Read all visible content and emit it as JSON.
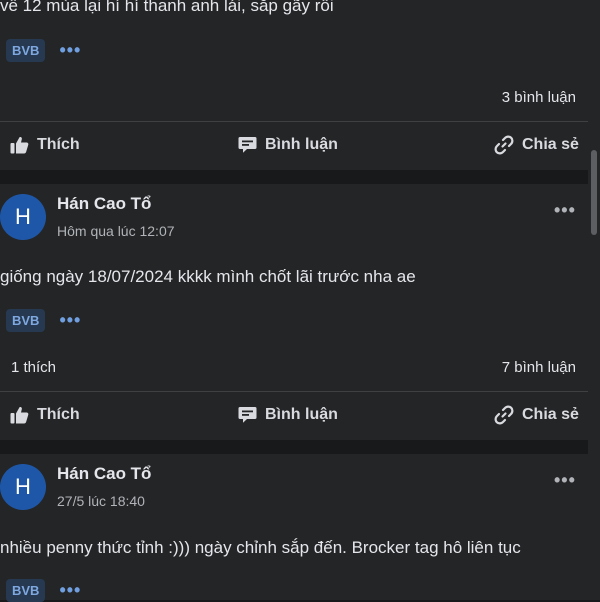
{
  "post1": {
    "text": "về 12 mùa lại hí hí thanh anh lái, sắp gãy rồi",
    "tag": "BVB",
    "comments": "3 bình luận"
  },
  "post2": {
    "author": "Hán Cao Tổ",
    "avatar_letter": "H",
    "time": "Hôm qua lúc 12:07",
    "text": "giống ngày 18/07/2024 kkkk mình chốt lãi trước nha ae",
    "tag": "BVB",
    "likes": "1 thích",
    "comments": "7 bình luận"
  },
  "post3": {
    "author": "Hán Cao Tổ",
    "avatar_letter": "H",
    "time": "27/5 lúc 18:40",
    "text": "nhiều penny thức tỉnh :))) ngày chỉnh sắp đến. Brocker tag hô liên tục",
    "tag": "BVB"
  },
  "actions": {
    "like": "Thích",
    "comment": "Bình luận",
    "share": "Chia sẻ"
  },
  "more_glyph": "•••",
  "colors": {
    "background": "#18191a",
    "card": "#242526",
    "avatar": "#1f57a8",
    "tag_bg": "#263951",
    "tag_text": "#7fa8e0"
  }
}
